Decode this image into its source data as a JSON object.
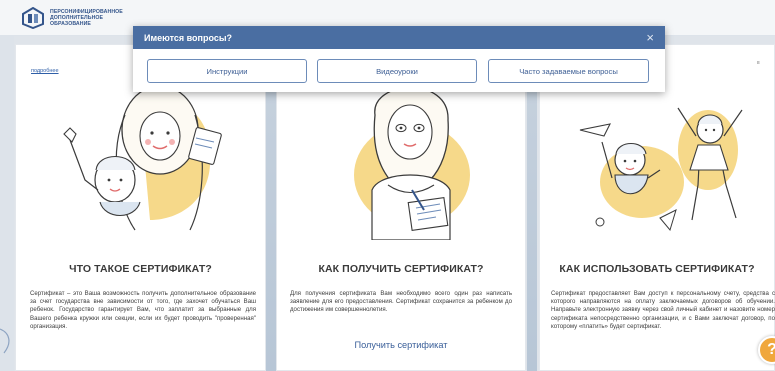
{
  "header": {
    "logo_lines": [
      "ПЕРСОНИФИЦИРОВАННОЕ",
      "ДОПОЛНИТЕЛЬНОЕ",
      "ОБРАЗОВАНИЕ"
    ]
  },
  "modal": {
    "title": "Имеются вопросы?",
    "close_label": "×",
    "buttons": [
      "Инструкции",
      "Видеоуроки",
      "Часто задаваемые вопросы"
    ]
  },
  "page": {
    "more_link": "подробнее",
    "corner_text": "в",
    "help_label": "?"
  },
  "cards": [
    {
      "title": "ЧТО ТАКОЕ СЕРТИФИКАТ?",
      "text": "Сертификат – это Ваша возможность получить дополнительное образование за счет государства вне зависимости от того, где захочет обучаться Ваш ребенок. Государство гарантирует Вам, что заплатит за выбранные для Вашего ребенка кружки или секции, если их будет проводить \"проверенная\" организация."
    },
    {
      "title": "КАК ПОЛУЧИТЬ СЕРТИФИКАТ?",
      "text": "Для получения сертификата Вам необходимо всего один раз написать заявление для его предоставления. Сертификат сохранится за ребенком до достижения им совершеннолетия.",
      "action_label": "Получить сертификат"
    },
    {
      "title": "КАК ИСПОЛЬЗОВАТЬ СЕРТИФИКАТ?",
      "text": "Сертификат предоставляет Вам доступ к персональному счету, средства с которого направляются на оплату заключаемых договоров об обучении. Направьте электронную заявку через свой личный кабинет и назовите номер сертификата непосредственно организации, и с Вами заключат договор, по которому «платить» будет сертификат."
    }
  ],
  "colors": {
    "modal_header": "#4a6ea2",
    "button_border": "#6d8cb9",
    "help_bubble": "#f0a73c",
    "illustration_accent": "#f6d98a"
  }
}
